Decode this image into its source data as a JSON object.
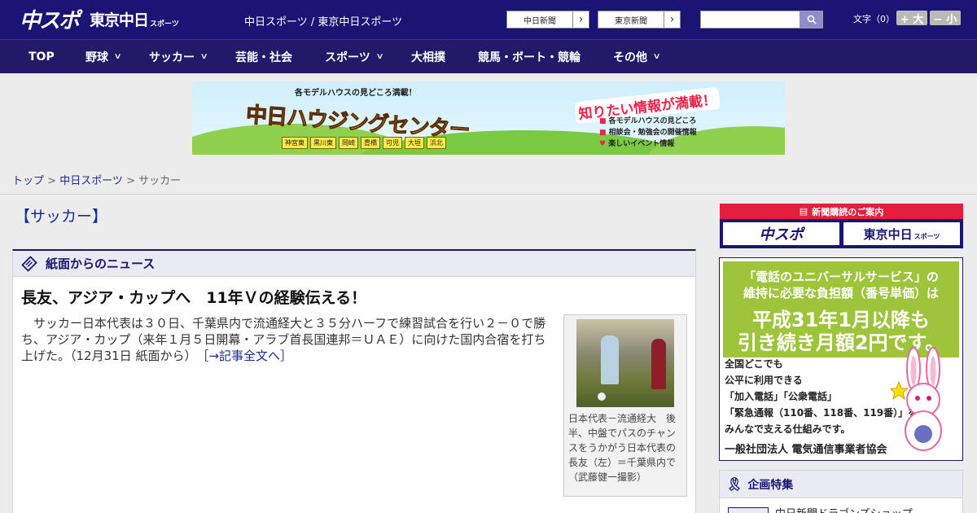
{
  "header": {
    "logo_main": "中スポ",
    "logo_sub": "東京中日",
    "logo_sub_small": "スポーツ",
    "site_names": "中日スポーツ / 東京中日スポーツ",
    "links": [
      {
        "label": "中日新聞"
      },
      {
        "label": "東京新聞"
      }
    ],
    "search_placeholder": "",
    "font_size_label": "文字（0）",
    "font_larger": "+ 大",
    "font_smaller": "− 小"
  },
  "nav": {
    "items": [
      {
        "label": "TOP",
        "has_menu": false
      },
      {
        "label": "野球",
        "has_menu": true
      },
      {
        "label": "サッカー",
        "has_menu": true
      },
      {
        "label": "芸能・社会",
        "has_menu": false
      },
      {
        "label": "スポーツ",
        "has_menu": true
      },
      {
        "label": "大相撲",
        "has_menu": false
      },
      {
        "label": "競馬・ボート・競輪",
        "has_menu": false
      },
      {
        "label": "その他",
        "has_menu": true
      }
    ]
  },
  "banner": {
    "top_text": "各モデルハウスの見どころ満載！",
    "title": "中日ハウジングセンター",
    "right_title": "知りたい情報が満載！",
    "towns": [
      "神宮東",
      "黒川東",
      "岡崎",
      "豊橋",
      "可児",
      "大垣",
      "浜北"
    ],
    "infos": [
      "各モデルハウスの見どころ",
      "相談会・勉強会の開催情報",
      "楽しいイベント情報"
    ]
  },
  "breadcrumb": {
    "items": [
      "トップ",
      "中日スポーツ"
    ],
    "current": "サッカー",
    "separator": " > "
  },
  "page_title": "【サッカー】",
  "news": {
    "section_label": "紙面からのニュース",
    "headline": "長友、アジア・カップへ　11年Ｖの経験伝える！",
    "body": "サッカー日本代表は３０日、千葉県内で流通経大と３５分ハーフで練習試合を行い２－０で勝ち、アジア・カップ（来年１月５日開幕・アラブ首長国連邦＝ＵＡＥ）に向けた国内合宿を打ち上げた。（12月31日 紙面から）",
    "more_link": "［→記事全文へ］",
    "photo_caption": "日本代表－流通経大　後半、中盤でパスのチャンスをうかがう日本代表の長友（左）＝千葉県内で（武藤健一撮影）"
  },
  "sidebar": {
    "subscribe_header": "新聞購読のご案内",
    "subscribe_buttons": [
      "中スポ",
      "東京中日"
    ],
    "subscribe_small": "スポーツ",
    "ad": {
      "lines": [
        "「電話のユニバーサルサービス」の",
        "維持に必要な負担額（番号単価）は",
        "平成31年1月以降も",
        "引き続き月額2円です。"
      ],
      "lower_lines": [
        "全国どこでも",
        "公平に利用できる",
        "「加入電話」「公衆電話」",
        "「緊急通報（110番、118番、119番）」を",
        "みんなで支える仕組みです。"
      ],
      "footer": "一般社団法人 電気通信事業者協会"
    },
    "feature_title": "企画特集",
    "feature_item": "中日新聞ドラゴンズショップ"
  },
  "colors": {
    "header_bg": "#1a1475",
    "nav_bg": "#221a68",
    "accent_red": "#e41e3c",
    "link": "#1a2a9a",
    "ad_green": "#9dc43a"
  }
}
